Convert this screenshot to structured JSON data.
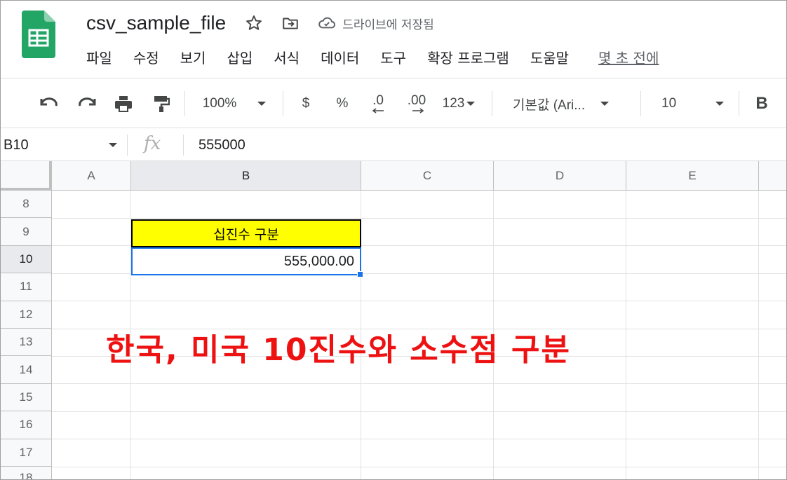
{
  "app": {
    "doc_title": "csv_sample_file",
    "save_status": "드라이브에 저장됨",
    "icons": [
      "sheets-logo-icon",
      "star-icon",
      "move-folder-icon",
      "cloud-saved-icon"
    ]
  },
  "menu": {
    "items": [
      "파일",
      "수정",
      "보기",
      "삽입",
      "서식",
      "데이터",
      "도구",
      "확장 프로그램",
      "도움말"
    ],
    "last_edit": "몇 초 전에"
  },
  "toolbar": {
    "zoom": "100%",
    "currency": "$",
    "percent": "%",
    "decrease_decimal": ".0",
    "increase_decimal": ".00",
    "more_formats": "123",
    "font": "기본값 (Ari...",
    "font_size": "10",
    "bold": "B"
  },
  "formula_bar": {
    "cell_ref": "B10",
    "fx": "fx",
    "value": "555000"
  },
  "grid": {
    "columns": [
      "A",
      "B",
      "C",
      "D",
      "E"
    ],
    "rows": [
      "8",
      "9",
      "10",
      "11",
      "12",
      "13",
      "14",
      "15",
      "16",
      "17",
      "18"
    ],
    "active_column": "B",
    "active_row": "10",
    "cells": {
      "b9": "십진수 구분",
      "b10": "555,000.00"
    },
    "header_cell_color": "#ffff00",
    "selection_color": "#1a73e8"
  },
  "annotation": {
    "text": "한국, 미국 10진수와 소수점 구분",
    "color": "#ee1111"
  }
}
